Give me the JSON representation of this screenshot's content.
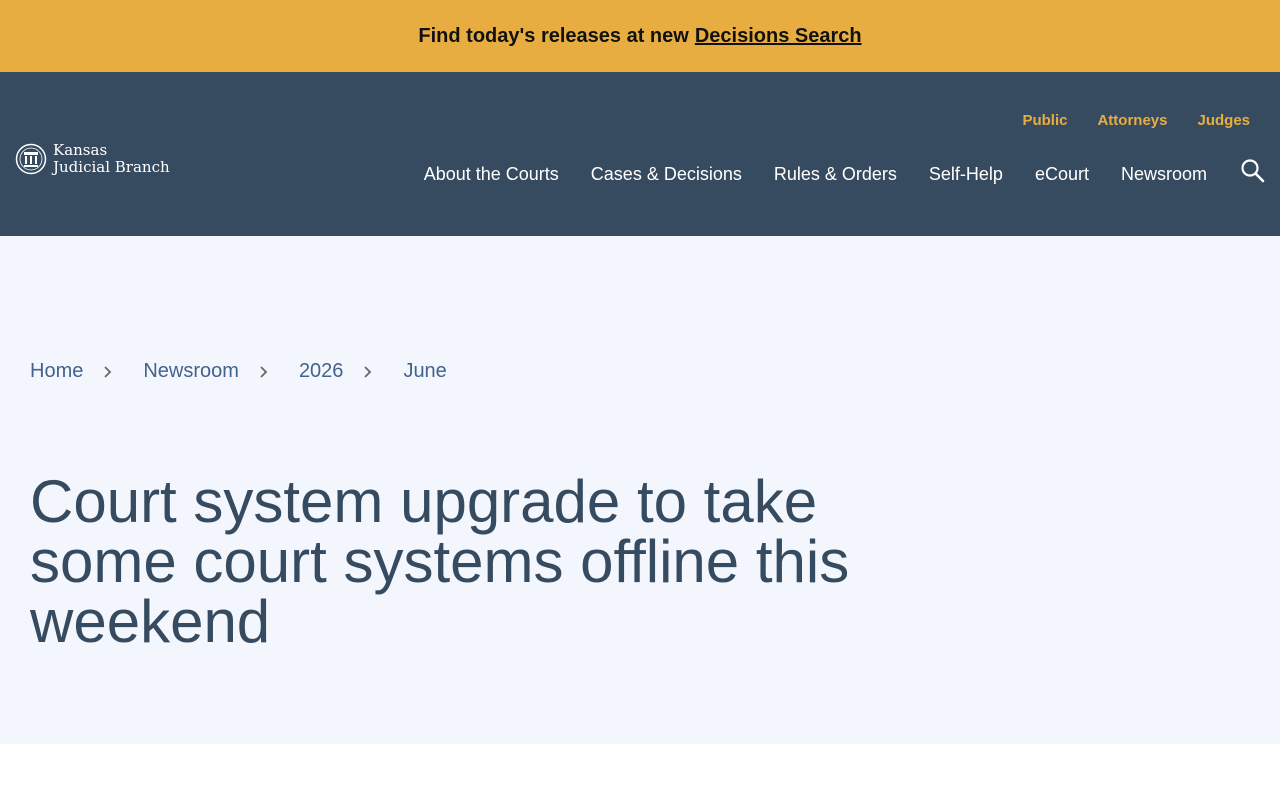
{
  "banner": {
    "text": "Find today's releases at new",
    "link_label": "Decisions Search",
    "bg_color": "#e7ad41"
  },
  "logo": {
    "line1": "Kansas",
    "line2": "Judicial Branch",
    "icon": "seal-icon"
  },
  "utility_nav": [
    {
      "label": "Public"
    },
    {
      "label": "Attorneys"
    },
    {
      "label": "Judges"
    }
  ],
  "main_nav": [
    {
      "label": "About the Courts"
    },
    {
      "label": "Cases & Decisions"
    },
    {
      "label": "Rules & Orders"
    },
    {
      "label": "Self-Help"
    },
    {
      "label": "eCourt"
    },
    {
      "label": "Newsroom"
    }
  ],
  "search": {
    "icon": "search-icon"
  },
  "breadcrumb": [
    {
      "label": "Home"
    },
    {
      "label": "Newsroom"
    },
    {
      "label": "2026"
    },
    {
      "label": "June"
    }
  ],
  "page_title": "Court system upgrade to take some court systems offline this weekend",
  "colors": {
    "header_bg": "#364b60",
    "accent": "#e7ad41",
    "hero_bg": "#f3f7fd",
    "link": "#43628d"
  }
}
